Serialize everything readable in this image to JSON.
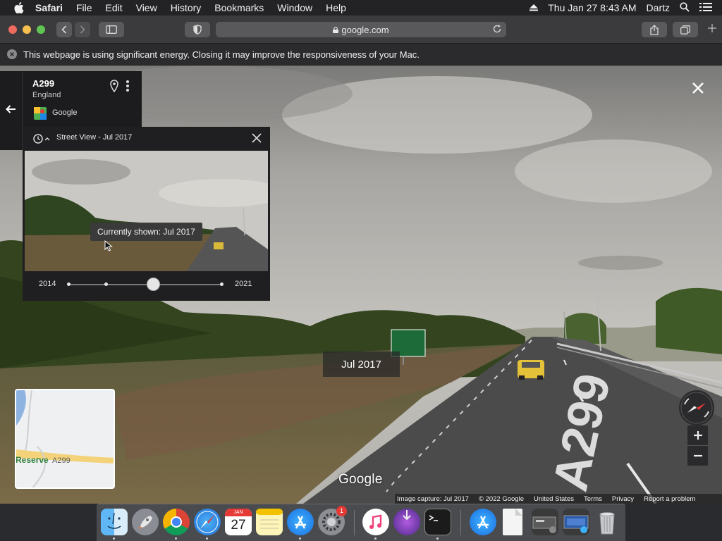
{
  "menubar": {
    "app": "Safari",
    "items": [
      "File",
      "Edit",
      "View",
      "History",
      "Bookmarks",
      "Window",
      "Help"
    ],
    "clock": "Thu Jan 27  8:43 AM",
    "user": "Dartz"
  },
  "toolbar": {
    "url": "google.com"
  },
  "banner": {
    "text": "This webpage is using significant energy. Closing it may improve the responsiveness of your Mac."
  },
  "streetview": {
    "address_title": "A299",
    "address_sub": "England",
    "provider": "Google",
    "timemachine_title": "Street View - Jul 2017",
    "tooltip": "Currently shown: Jul 2017",
    "year_start": "2014",
    "year_end": "2021",
    "slider_selected_index": 2,
    "slider_count": 4,
    "date_chip": "Jul 2017",
    "minimap_place": "Reserve",
    "minimap_road": "A299",
    "logo": "Google",
    "footer": [
      "Image capture: Jul 2017",
      "© 2022 Google",
      "United States",
      "Terms",
      "Privacy",
      "Report a problem"
    ]
  },
  "dock": {
    "calendar_month": "JAN",
    "calendar_day": "27",
    "settings_badge": "1",
    "icons": [
      "finder-icon",
      "launchpad-icon",
      "chrome-icon",
      "safari-icon",
      "calendar-icon",
      "notes-icon",
      "app-store-icon",
      "system-preferences-icon",
      "music-icon",
      "downloads-icon",
      "terminal-icon",
      "app-store-folder-icon",
      "document-icon",
      "screenshots-folder-icon",
      "preview-folder-icon",
      "trash-icon"
    ]
  },
  "colors": {
    "sky": "#b9b6b0",
    "road": "#4a4a4a",
    "panel": "#1f1f21",
    "accent_red": "#e53935"
  }
}
